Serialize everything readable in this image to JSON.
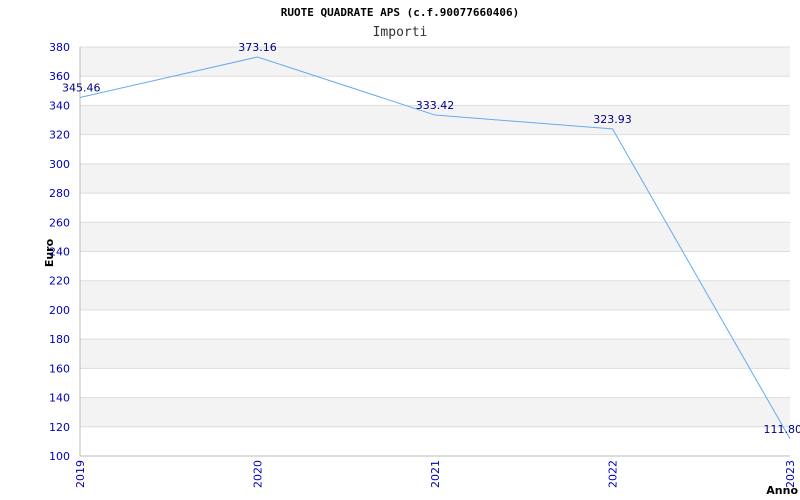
{
  "chart_data": {
    "type": "line",
    "title": "RUOTE QUADRATE APS (c.f.90077660406)",
    "subtitle": "Importi",
    "xlabel": "Anno",
    "ylabel": "Euro",
    "categories": [
      "2019",
      "2020",
      "2021",
      "2022",
      "2023"
    ],
    "values": [
      345.46,
      373.16,
      333.42,
      323.93,
      111.8
    ],
    "data_labels": [
      "345.46",
      "373.16",
      "333.42",
      "323.93",
      "111.80"
    ],
    "ylim": [
      100,
      380
    ],
    "yticks": [
      100,
      120,
      140,
      160,
      180,
      200,
      220,
      240,
      260,
      280,
      300,
      320,
      340,
      360,
      380
    ],
    "grid": true,
    "line_color": "#66aaee",
    "tick_color": "#0000bb",
    "label_color": "#000080",
    "band_color": "#f3f3f3"
  }
}
